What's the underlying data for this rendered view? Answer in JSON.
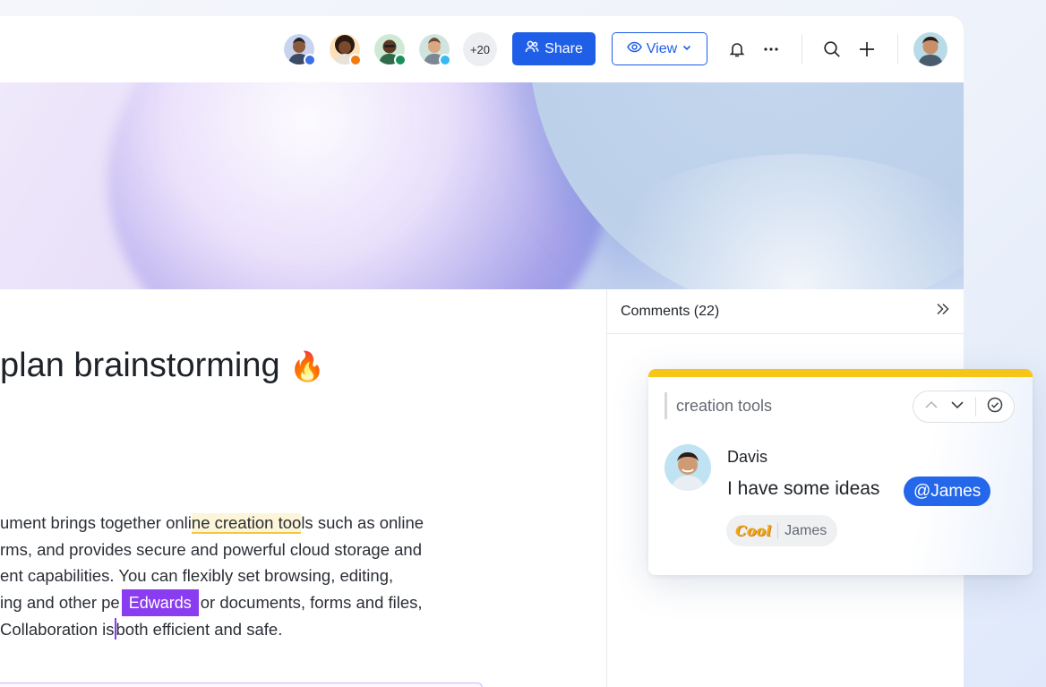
{
  "topbar": {
    "collaborators": [
      {
        "name": "collaborator-1",
        "status_color": "#3b6fe8",
        "skin": "#8a5a3c",
        "bg": "#c9d3f0"
      },
      {
        "name": "collaborator-2",
        "status_color": "#f07a10",
        "skin": "#7a4a2c",
        "bg": "#fde0b8"
      },
      {
        "name": "collaborator-3",
        "status_color": "#1a8f5c",
        "skin": "#5a3a24",
        "bg": "#cfe9d6"
      },
      {
        "name": "collaborator-4",
        "status_color": "#36b8f5",
        "skin": "#d8a882",
        "bg": "#cfe4df"
      }
    ],
    "more_count": "+20",
    "share_label": "Share",
    "view_label": "View"
  },
  "document": {
    "title": "plan brainstorming",
    "title_emoji": "🔥",
    "paragraph": {
      "line1_pre": "ument brings together onli",
      "line1_hl_a": "ne creation too",
      "line1_post": "ls such as online",
      "line2": "rms, and provides secure and powerful cloud storage and",
      "line3": "ent capabilities. You can flexibly set browsing, editing,",
      "line4_pre": "ing and other pe",
      "line4_cursor_name": "Edwards",
      "line4_post": "or documents, forms and files,",
      "line5_pre": "Collaboration is",
      "line5_post": "both efficient and safe."
    }
  },
  "comments": {
    "header": "Comments (22)",
    "card": {
      "quote": "creation tools",
      "author": "Davis",
      "text": "I have some ideas",
      "mention": "@James",
      "reaction_label": "Cool",
      "reaction_user": "James"
    }
  },
  "colors": {
    "accent": "#1f5fe8",
    "cursor": "#8a3df0",
    "highlight_bar": "#f5c518"
  }
}
